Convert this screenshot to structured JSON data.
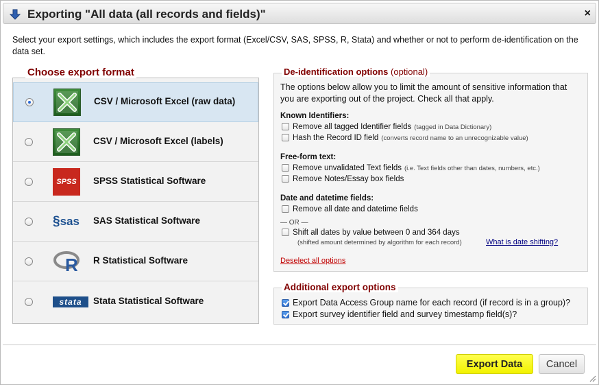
{
  "dialog": {
    "title": "Exporting \"All data (all records and fields)\"",
    "title_icon": "down-arrow-icon",
    "close_label": "×",
    "intro": "Select your export settings, which includes the export format (Excel/CSV, SAS, SPSS, R, Stata) and whether or not to perform de-identification on the data set."
  },
  "format_section": {
    "legend": "Choose export format",
    "options": [
      {
        "label": "CSV / Microsoft Excel (raw data)",
        "icon": "excel-icon",
        "selected": true
      },
      {
        "label": "CSV / Microsoft Excel (labels)",
        "icon": "excel-icon",
        "selected": false
      },
      {
        "label": "SPSS Statistical Software",
        "icon": "spss-icon",
        "icon_text": "SPSS",
        "selected": false
      },
      {
        "label": "SAS Statistical Software",
        "icon": "sas-icon",
        "icon_text": "sas",
        "selected": false
      },
      {
        "label": "R Statistical Software",
        "icon": "r-icon",
        "icon_text": "R",
        "selected": false
      },
      {
        "label": "Stata Statistical Software",
        "icon": "stata-icon",
        "icon_text": "stata",
        "selected": false
      }
    ]
  },
  "deid_section": {
    "legend_bold": "De-identification options",
    "legend_optional": "(optional)",
    "description": "The options below allow you to limit the amount of sensitive information that you are exporting out of the project. Check all that apply.",
    "known_identifiers": {
      "title": "Known Identifiers:",
      "remove_tagged": {
        "label": "Remove all tagged Identifier fields",
        "note": "(tagged in Data Dictionary)",
        "checked": false
      },
      "hash_record": {
        "label": "Hash the Record ID field",
        "note": "(converts record name to an unrecognizable value)",
        "checked": false
      }
    },
    "free_form": {
      "title": "Free-form text:",
      "remove_text": {
        "label": "Remove unvalidated Text fields",
        "note": "(i.e. Text fields other than dates, numbers, etc.)",
        "checked": false
      },
      "remove_notes": {
        "label": "Remove Notes/Essay box fields",
        "checked": false
      }
    },
    "dates": {
      "title": "Date and datetime fields:",
      "remove_dates": {
        "label": "Remove all date and datetime fields",
        "checked": false
      },
      "or_text": "— OR —",
      "shift_dates": {
        "label": "Shift all dates by value between 0 and 364 days",
        "note": "(shifted amount determined by algorithm for each record)",
        "checked": false
      },
      "what_link": "What is date shifting?"
    },
    "deselect_link": "Deselect all options"
  },
  "additional_section": {
    "legend": "Additional export options",
    "options": [
      {
        "label": "Export Data Access Group name for each record (if record is in a group)?",
        "checked": true
      },
      {
        "label": "Export survey identifier field and survey timestamp field(s)?",
        "checked": true
      }
    ]
  },
  "footer": {
    "export_label": "Export Data",
    "cancel_label": "Cancel"
  },
  "colors": {
    "legend_red": "#800000",
    "export_yellow": "#ffff00",
    "selected_row": "#d8e6f2"
  }
}
